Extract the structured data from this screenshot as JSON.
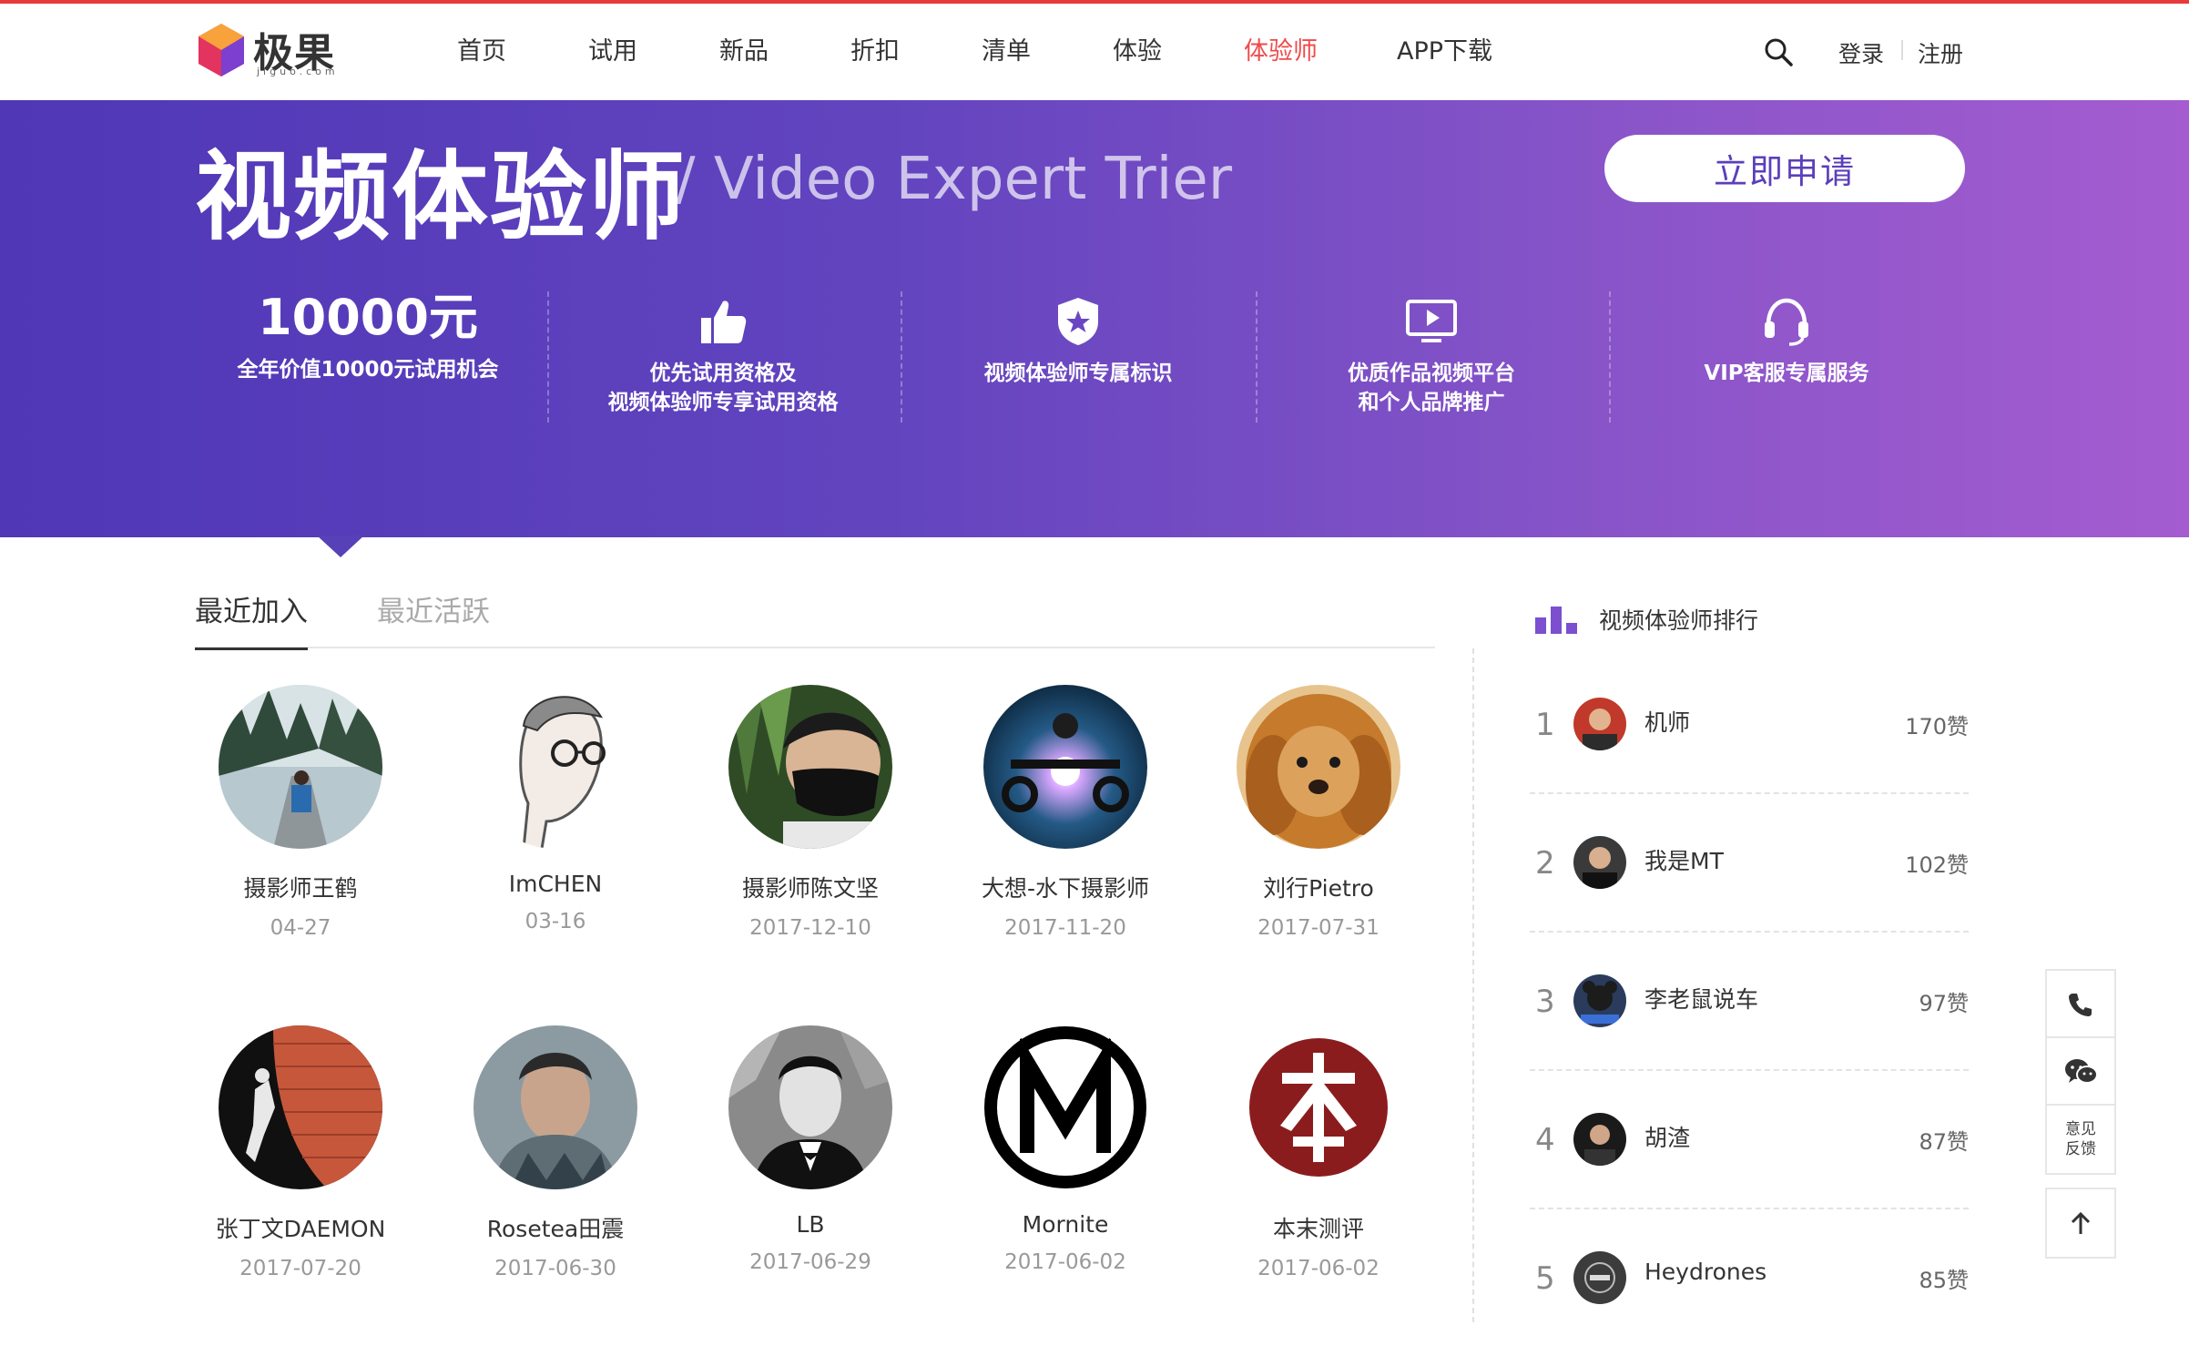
{
  "header": {
    "logo_text": "极果",
    "logo_sub": "jiguo.com",
    "nav": [
      "首页",
      "试用",
      "新品",
      "折扣",
      "清单",
      "体验",
      "体验师",
      "APP下载"
    ],
    "active_nav": "体验师",
    "login": "登录",
    "register": "注册"
  },
  "banner": {
    "title": "视频体验师",
    "subtitle": "/ Video Expert Trier",
    "apply_label": "立即申请",
    "benefits": [
      {
        "big": "10000元",
        "text": "全年价值10000元试用机会",
        "icon": "value-text"
      },
      {
        "text": "优先试用资格及\n视频体验师专享试用资格",
        "icon": "thumbs-up-icon"
      },
      {
        "text": "视频体验师专属标识",
        "icon": "shield-star-icon"
      },
      {
        "text": "优质作品视频平台\n和个人品牌推广",
        "icon": "video-screen-icon"
      },
      {
        "text": "VIP客服专属服务",
        "icon": "headset-icon"
      }
    ]
  },
  "tabs": [
    "最近加入",
    "最近活跃"
  ],
  "users": [
    {
      "name": "摄影师王鹤",
      "date": "04-27"
    },
    {
      "name": "ImCHEN",
      "date": "03-16"
    },
    {
      "name": "摄影师陈文坚",
      "date": "2017-12-10"
    },
    {
      "name": "大想-水下摄影师",
      "date": "2017-11-20"
    },
    {
      "name": "刘行Pietro",
      "date": "2017-07-31"
    },
    {
      "name": "张丁文DAEMON",
      "date": "2017-07-20"
    },
    {
      "name": "Rosetea田震",
      "date": "2017-06-30"
    },
    {
      "name": "LB",
      "date": "2017-06-29"
    },
    {
      "name": "Mornite",
      "date": "2017-06-02"
    },
    {
      "name": "本末测评",
      "date": "2017-06-02"
    }
  ],
  "ranking": {
    "title": "视频体验师排行",
    "rows": [
      {
        "rank": "1",
        "name": "机师",
        "likes": "170赞"
      },
      {
        "rank": "2",
        "name": "我是MT",
        "likes": "102赞"
      },
      {
        "rank": "3",
        "name": "李老鼠说车",
        "likes": "97赞"
      },
      {
        "rank": "4",
        "name": "胡渣",
        "likes": "87赞"
      },
      {
        "rank": "5",
        "name": "Heydrones",
        "likes": "85赞"
      }
    ]
  },
  "tools": {
    "feedback": "意见\n反馈"
  },
  "colors": {
    "accent_red": "#ef4a4a",
    "banner_start": "#4f37b6",
    "banner_end": "#a45cd0",
    "rank_purple": "#7b4fcf"
  }
}
